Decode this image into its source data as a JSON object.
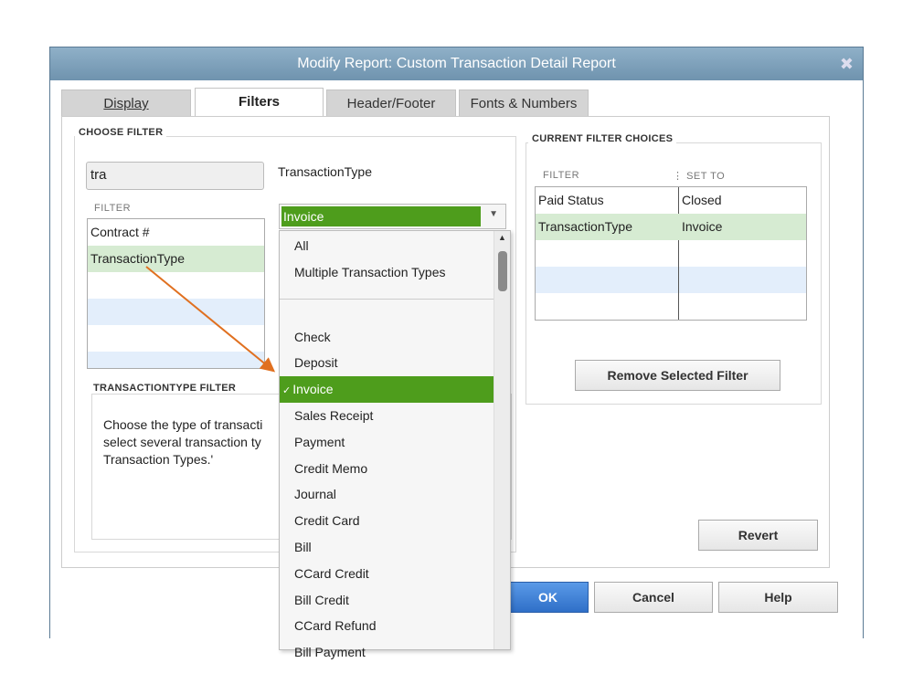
{
  "window": {
    "title": "Modify Report: Custom Transaction Detail Report",
    "close_icon": "close-icon"
  },
  "tabs": [
    {
      "label": "Display"
    },
    {
      "label": "Filters",
      "active": true
    },
    {
      "label": "Header/Footer"
    },
    {
      "label": "Fonts & Numbers"
    }
  ],
  "choose_filter": {
    "label": "CHOOSE FILTER",
    "search_value": "tra",
    "filter_header": "FILTER",
    "items": [
      "Contract #",
      "TransactionType"
    ],
    "selected": "TransactionType",
    "field_label": "TransactionType",
    "select_value": "Invoice"
  },
  "description": {
    "label": "TRANSACTIONTYPE FILTER",
    "text": [
      "Choose the type of transacti",
      "select several transaction ty",
      "Transaction Types.'"
    ]
  },
  "dropdown": {
    "items": [
      "All",
      "Multiple Transaction Types",
      "Check",
      "Deposit",
      "Invoice",
      "Sales Receipt",
      "Payment",
      "Credit Memo",
      "Journal",
      "Credit Card",
      "Bill",
      "CCard Credit",
      "Bill Credit",
      "CCard Refund",
      "Bill Payment"
    ],
    "selected": "Invoice",
    "check": "✓"
  },
  "current_filters": {
    "label": "CURRENT FILTER CHOICES",
    "col_filter": "FILTER",
    "col_set_to": "SET TO",
    "rows": [
      {
        "filter": "Paid Status",
        "set_to": "Closed"
      },
      {
        "filter": "TransactionType",
        "set_to": "Invoice"
      }
    ],
    "remove_button": "Remove Selected Filter"
  },
  "buttons": {
    "revert": "Revert",
    "ok": "OK",
    "cancel": "Cancel",
    "help": "Help"
  },
  "colors": {
    "accent_green": "#4e9d1c",
    "selected_row": "#d6ebd2",
    "arrow": "#e07020",
    "ok_blue": "#3a7fd8"
  }
}
